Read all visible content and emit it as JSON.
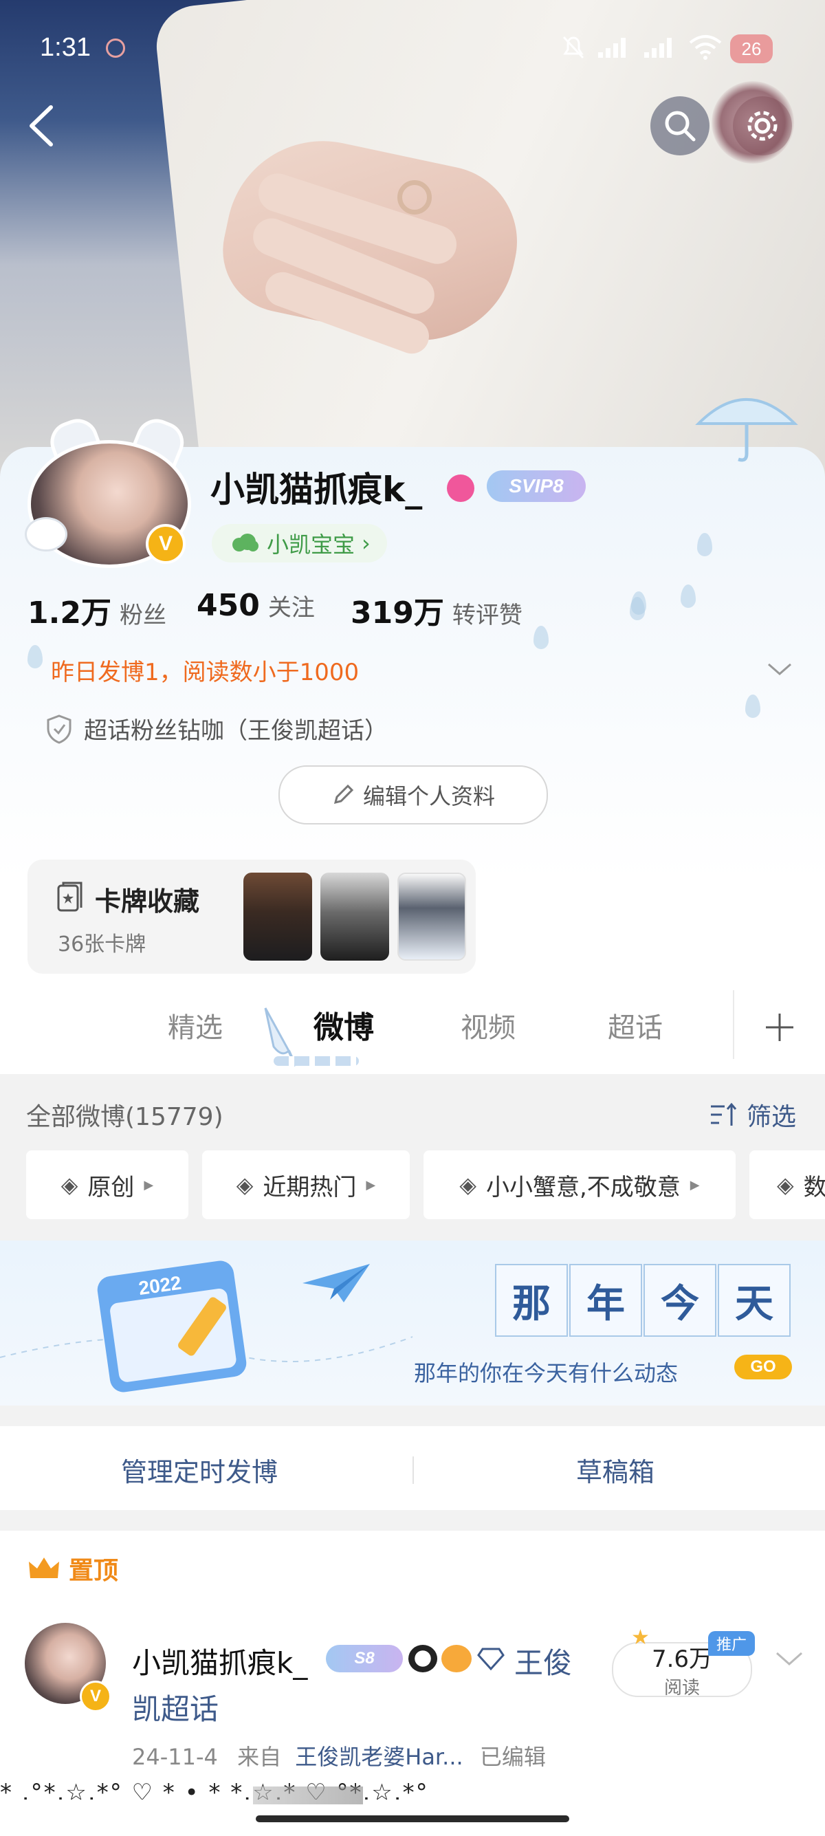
{
  "status_bar": {
    "time": "1:31",
    "battery": "26"
  },
  "profile": {
    "username": "小凯猫抓痕k_",
    "vip_label": "SVIP8",
    "tag_label": "小凯宝宝",
    "tag_chevron": "›",
    "stats": [
      {
        "value": "1.2万",
        "label": "粉丝"
      },
      {
        "value": "450",
        "label": "关注"
      },
      {
        "value": "319万",
        "label": "转评赞"
      }
    ],
    "notice": "昨日发博1，阅读数小于1000",
    "super_topic": "超话粉丝钻咖（王俊凯超话）",
    "edit_button": "编辑个人资料"
  },
  "cards": {
    "title": "卡牌收藏",
    "count": "36张卡牌"
  },
  "tabs": [
    "精选",
    "微博",
    "视频",
    "超话"
  ],
  "active_tab": "微博",
  "feed": {
    "all_label": "全部微博(15779)",
    "filter_label": "筛选",
    "chips": [
      "原创",
      "近期热门",
      "小小蟹意,不成敬意",
      "数"
    ]
  },
  "banner": {
    "year": "2022",
    "title_chars": [
      "那",
      "年",
      "今",
      "天"
    ],
    "subtitle": "那年的你在今天有什么动态",
    "go": "GO"
  },
  "actions": {
    "scheduled": "管理定时发博",
    "drafts": "草稿箱"
  },
  "pinned": {
    "label": "置顶",
    "name": "小凯猫抓痕k_",
    "badge": "S8",
    "topic_line1": "王俊",
    "topic_line2": "凯超话",
    "reads": "7.6万",
    "reads_label": "阅读",
    "promo": "推广",
    "date": "24-11-4",
    "from_label": "来自",
    "source": "王俊凯老婆Har...",
    "edited": "已编辑",
    "preview_line": "* .°*.☆.*° ♡ * •                * *.☆.* ♡ °*.☆.*°"
  },
  "colors": {
    "accent_orange": "#ef6a1f",
    "link_blue": "#3e5a8a",
    "vip_gold": "#f5b316"
  }
}
